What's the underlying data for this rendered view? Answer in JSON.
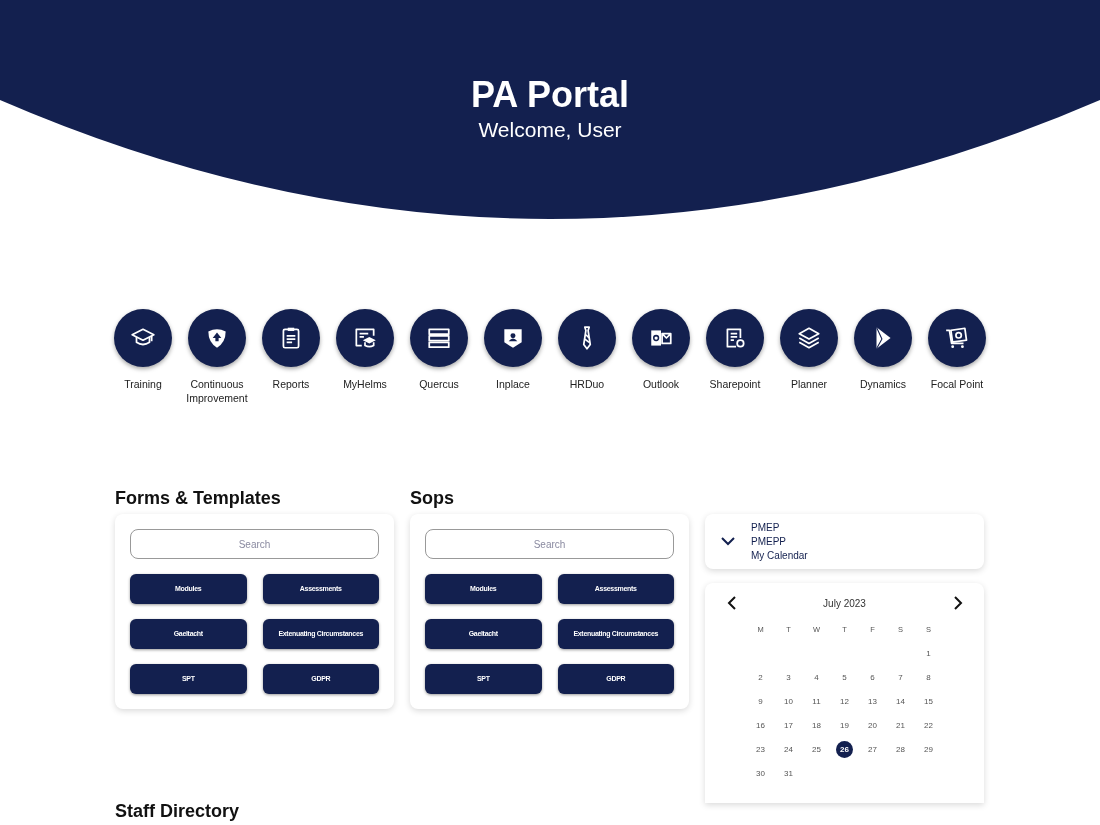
{
  "header": {
    "title": "PA Portal",
    "subtitle": "Welcome, User"
  },
  "apps": [
    {
      "label": "Training"
    },
    {
      "label": "Continuous Improvement"
    },
    {
      "label": "Reports"
    },
    {
      "label": "MyHelms"
    },
    {
      "label": "Quercus"
    },
    {
      "label": "Inplace"
    },
    {
      "label": "HRDuo"
    },
    {
      "label": "Outlook"
    },
    {
      "label": "Sharepoint"
    },
    {
      "label": "Planner"
    },
    {
      "label": "Dynamics"
    },
    {
      "label": "Focal Point"
    }
  ],
  "panels": [
    {
      "title": "Forms & Templates",
      "search": {
        "placeholder": "Search"
      },
      "buttons": [
        "Modules",
        "Assessments",
        "Gaeltacht",
        "Extenuating Circumstances",
        "SPT",
        "GDPR"
      ]
    },
    {
      "title": "Sops",
      "search": {
        "placeholder": "Search"
      },
      "buttons": [
        "Modules",
        "Assessments",
        "Gaeltacht",
        "Extenuating Circumstances",
        "SPT",
        "GDPR"
      ]
    }
  ],
  "calendar_selector": {
    "expanded": false,
    "options": [
      "PMEP",
      "PMEPP",
      "My Calendar"
    ]
  },
  "calendar": {
    "month": "July 2023",
    "weekdays": [
      "M",
      "T",
      "W",
      "T",
      "F",
      "S",
      "S"
    ],
    "weeks": [
      {
        "kind": "lead",
        "days": [
          {
            "label": "1",
            "selected": false
          }
        ]
      },
      {
        "kind": "full",
        "days": [
          {
            "label": "2",
            "selected": false
          },
          {
            "label": "3",
            "selected": false
          },
          {
            "label": "4",
            "selected": false
          },
          {
            "label": "5",
            "selected": false
          },
          {
            "label": "6",
            "selected": false
          },
          {
            "label": "7",
            "selected": false
          },
          {
            "label": "8",
            "selected": false
          }
        ]
      },
      {
        "kind": "full",
        "days": [
          {
            "label": "9",
            "selected": false
          },
          {
            "label": "10",
            "selected": false
          },
          {
            "label": "11",
            "selected": false
          },
          {
            "label": "12",
            "selected": false
          },
          {
            "label": "13",
            "selected": false
          },
          {
            "label": "14",
            "selected": false
          },
          {
            "label": "15",
            "selected": false
          }
        ]
      },
      {
        "kind": "full",
        "days": [
          {
            "label": "16",
            "selected": false
          },
          {
            "label": "17",
            "selected": false
          },
          {
            "label": "18",
            "selected": false
          },
          {
            "label": "19",
            "selected": false
          },
          {
            "label": "20",
            "selected": false
          },
          {
            "label": "21",
            "selected": false
          },
          {
            "label": "22",
            "selected": false
          }
        ]
      },
      {
        "kind": "full",
        "days": [
          {
            "label": "23",
            "selected": false
          },
          {
            "label": "24",
            "selected": false
          },
          {
            "label": "25",
            "selected": false
          },
          {
            "label": "26",
            "selected": true
          },
          {
            "label": "27",
            "selected": false
          },
          {
            "label": "28",
            "selected": false
          },
          {
            "label": "29",
            "selected": false
          }
        ]
      },
      {
        "kind": "trail",
        "days": [
          {
            "label": "30",
            "selected": false
          },
          {
            "label": "31",
            "selected": false
          }
        ]
      }
    ]
  },
  "staff_directory": {
    "title": "Staff Directory"
  }
}
